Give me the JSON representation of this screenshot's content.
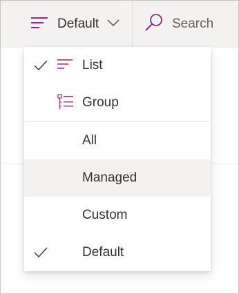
{
  "toolbar": {
    "view_label": "Default",
    "search_label": "Search"
  },
  "menu": {
    "items": [
      {
        "label": "List",
        "checked": true,
        "icon": "list-lines-icon"
      },
      {
        "label": "Group",
        "checked": false,
        "icon": "group-list-icon"
      },
      {
        "label": "All",
        "checked": false
      },
      {
        "label": "Managed",
        "checked": false,
        "highlighted": true
      },
      {
        "label": "Custom",
        "checked": false
      },
      {
        "label": "Default",
        "checked": true
      }
    ]
  },
  "colors": {
    "accent": "#8b2b83",
    "text": "#323130",
    "toolbar_bg": "#f3f2f1",
    "hover_bg": "#f3f2f1"
  }
}
